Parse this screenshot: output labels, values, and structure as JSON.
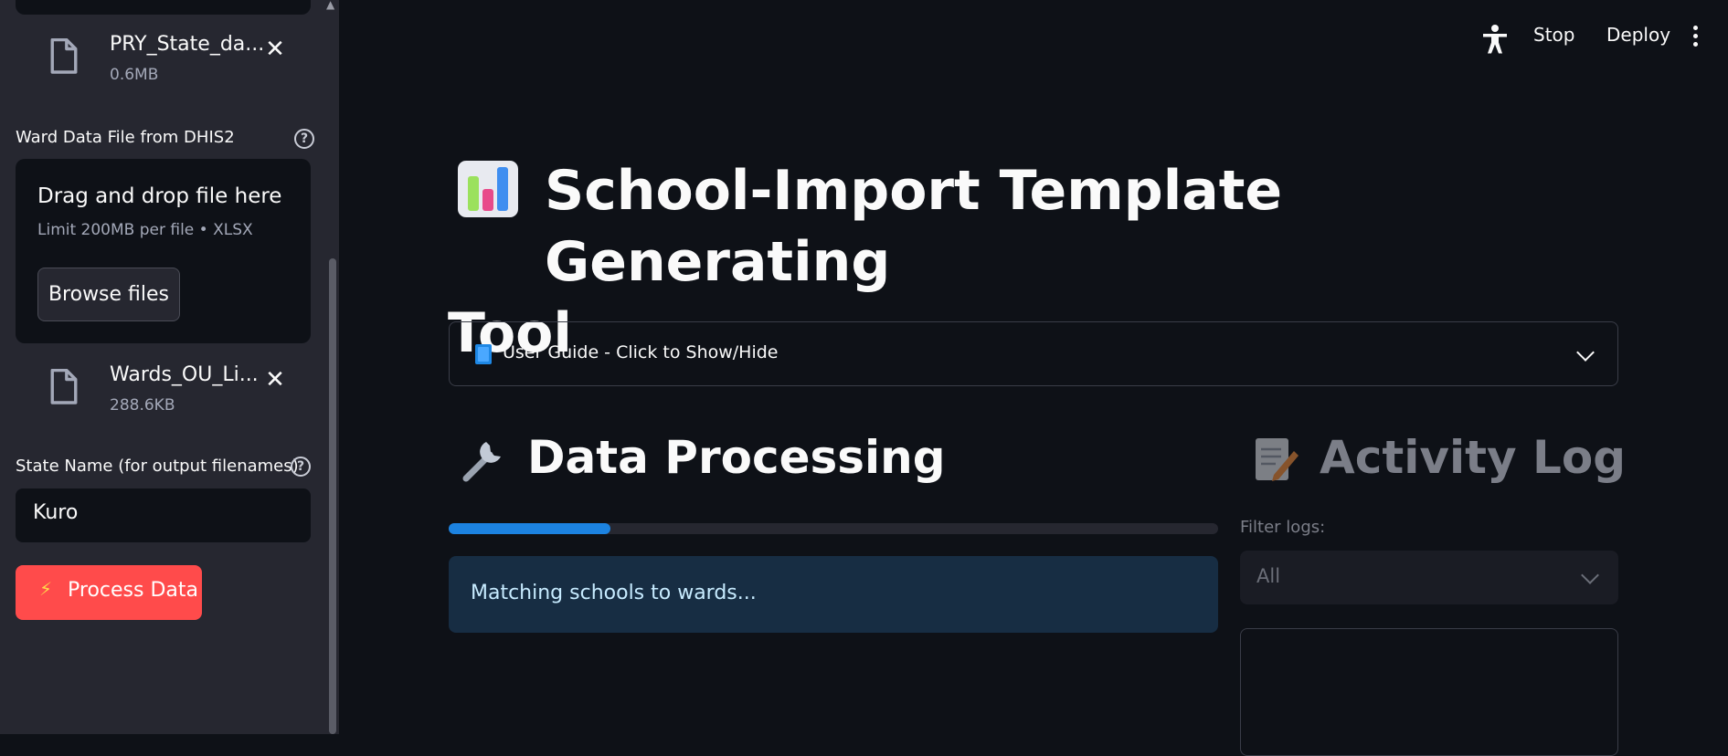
{
  "sidebar": {
    "files": [
      {
        "name": "PRY_State_da...",
        "size": "0.6MB"
      },
      {
        "name": "Wards_OU_Li...",
        "size": "288.6KB"
      }
    ],
    "ward_upload": {
      "label": "Ward Data File from DHIS2",
      "dropzone_title": "Drag and drop file here",
      "dropzone_limit": "Limit 200MB per file • XLSX",
      "browse_label": "Browse files"
    },
    "state_name": {
      "label": "State Name (for output filenames)",
      "value": "Kuro"
    },
    "process_button": {
      "icon": "⚡",
      "label": "Process Data"
    }
  },
  "header": {
    "stop_label": "Stop",
    "deploy_label": "Deploy"
  },
  "main": {
    "title_line1": "School-Import Template Generating",
    "title_line2": "Tool",
    "guide_expander": "User Guide - Click to Show/Hide",
    "data_processing": {
      "heading": "Data Processing",
      "progress_fraction": 0.21,
      "status_message": "Matching schools to wards..."
    },
    "activity_log": {
      "heading": "Activity Log",
      "filter_label": "Filter logs:",
      "filter_value": "All"
    }
  },
  "colors": {
    "accent": "#ff4b4b",
    "progress": "#1c83e1",
    "info_bg": "#172d43",
    "background": "#0e1117",
    "sidebar": "#262730"
  }
}
